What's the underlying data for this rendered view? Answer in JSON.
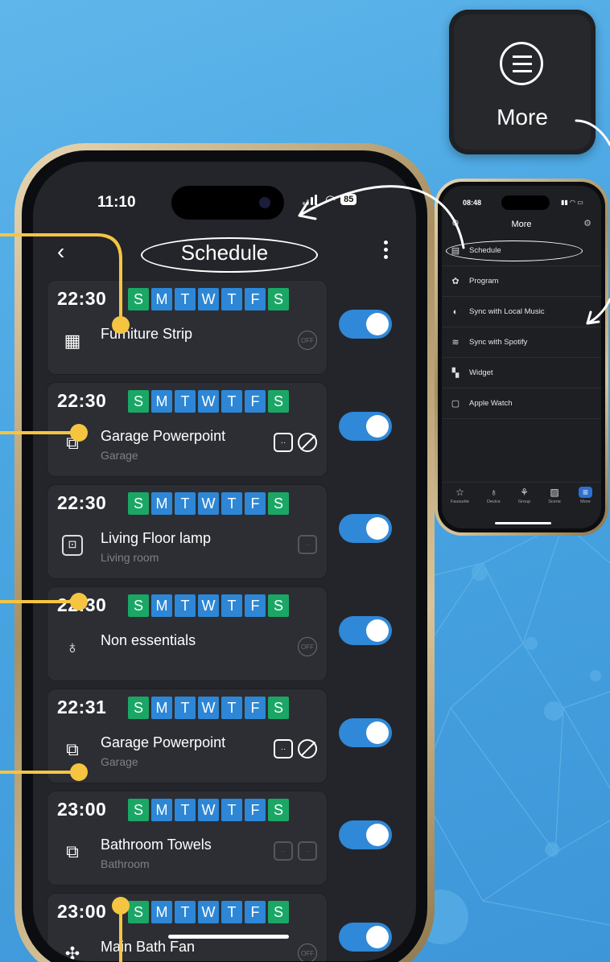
{
  "main_phone": {
    "status_time": "11:10",
    "battery": "85",
    "back_glyph": "‹",
    "title": "Schedule",
    "day_letters": [
      "S",
      "M",
      "T",
      "W",
      "T",
      "F",
      "S"
    ],
    "schedules": [
      {
        "time": "22:30",
        "name": "Furniture Strip",
        "sub": "",
        "icon": "power-strip-icon",
        "status": [
          "off"
        ],
        "enabled": true
      },
      {
        "time": "22:30",
        "name": "Garage Powerpoint",
        "sub": "Garage",
        "icon": "double-socket-icon",
        "status": [
          "socket",
          "ban"
        ],
        "enabled": true
      },
      {
        "time": "22:30",
        "name": "Living Floor lamp",
        "sub": "Living room",
        "icon": "socket-icon",
        "status": [
          "socket-dim"
        ],
        "enabled": true
      },
      {
        "time": "22:30",
        "name": "Non essentials",
        "sub": "",
        "icon": "bulb-icon",
        "status": [
          "off"
        ],
        "enabled": true
      },
      {
        "time": "22:31",
        "name": "Garage Powerpoint",
        "sub": "Garage",
        "icon": "double-socket-icon",
        "status": [
          "socket",
          "ban"
        ],
        "enabled": true
      },
      {
        "time": "23:00",
        "name": "Bathroom Towels",
        "sub": "Bathroom",
        "icon": "double-socket-icon",
        "status": [
          "socket-dim",
          "socket-dim"
        ],
        "enabled": true
      },
      {
        "time": "23:00",
        "name": "Main Bath Fan",
        "sub": "",
        "icon": "fan-icon",
        "status": [
          "off"
        ],
        "enabled": true
      }
    ],
    "colors": {
      "weekend": "#1aa766",
      "weekday": "#2d87d6",
      "toggle": "#2f88d8",
      "annotation": "#f5c542"
    }
  },
  "more_button": {
    "label": "More"
  },
  "small_phone": {
    "status_time": "08:48",
    "title": "More",
    "menu": [
      {
        "label": "Schedule",
        "icon": "schedule-icon"
      },
      {
        "label": "Program",
        "icon": "program-icon"
      },
      {
        "label": "Sync with Local Music",
        "icon": "music-icon"
      },
      {
        "label": "Sync with Spotify",
        "icon": "spotify-icon"
      },
      {
        "label": "Widget",
        "icon": "widget-icon"
      },
      {
        "label": "Apple Watch",
        "icon": "watch-icon"
      }
    ],
    "tabs": [
      {
        "label": "Favourite",
        "icon": "star-icon"
      },
      {
        "label": "Device",
        "icon": "bulb-icon"
      },
      {
        "label": "Group",
        "icon": "group-icon"
      },
      {
        "label": "Scene",
        "icon": "scene-icon"
      },
      {
        "label": "More",
        "icon": "more-icon",
        "active": true
      }
    ]
  }
}
